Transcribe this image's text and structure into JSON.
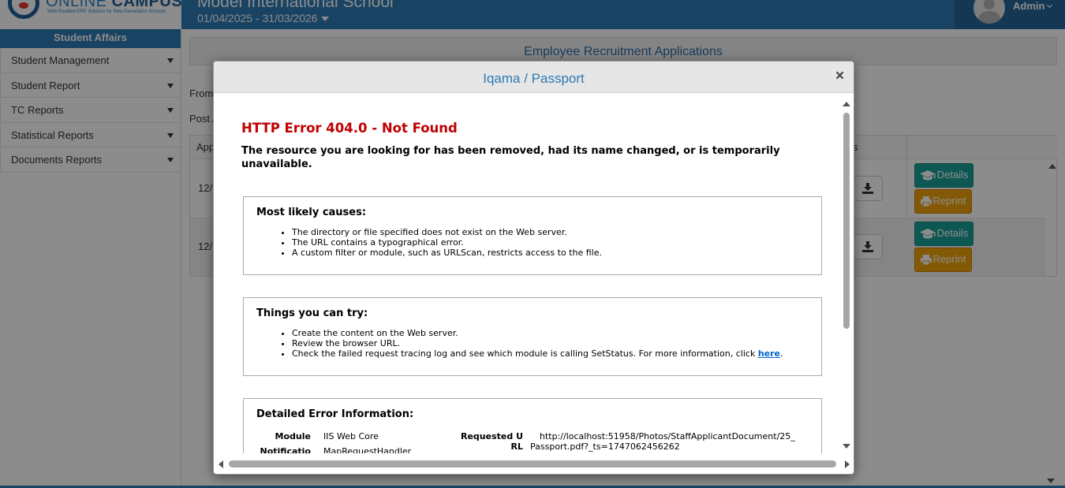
{
  "app": {
    "logo_brand_a": "ONLINE",
    "logo_brand_b": "CAMPUS",
    "logo_tagline": "Web Enabled ERP Solution for New Generation Schools",
    "school_name": "Model International School",
    "session": "01/04/2025 - 31/03/2026",
    "user": "Admin"
  },
  "sidebar": {
    "header": "Student Affairs",
    "items": [
      {
        "label": "Student Management"
      },
      {
        "label": "Student Report"
      },
      {
        "label": "TC Reports"
      },
      {
        "label": "Statistical Reports"
      },
      {
        "label": "Documents Reports"
      }
    ]
  },
  "main": {
    "title": "Employee Recruitment Applications",
    "from_label": "From",
    "post_label": "Post A",
    "grid_head_left": "App",
    "grid_head_right": "s",
    "rows": [
      {
        "date": "12/",
        "details": "Details",
        "reprint": "Reprint"
      },
      {
        "date": "12/",
        "details": "Details",
        "reprint": "Reprint"
      }
    ]
  },
  "modal": {
    "title": "Iqama / Passport",
    "close": "×",
    "error_title": "HTTP Error 404.0 - Not Found",
    "error_subtitle": "The resource you are looking for has been removed, had its name changed, or is temporarily unavailable.",
    "causes": {
      "heading": "Most likely causes:",
      "items": [
        "The directory or file specified does not exist on the Web server.",
        "The URL contains a typographical error.",
        "A custom filter or module, such as URLScan, restricts access to the file."
      ]
    },
    "try": {
      "heading": "Things you can try:",
      "items": [
        "Create the content on the Web server.",
        "Review the browser URL."
      ],
      "item3_prefix": "Check the failed request tracing log and see which module is calling SetStatus. For more information, click ",
      "item3_link": "here",
      "item3_suffix": "."
    },
    "detail": {
      "heading": "Detailed Error Information:",
      "module_label": "Module",
      "module_value": "IIS Web Core",
      "notification_label": "Notificatio",
      "notification_value": "MapRequestHandler",
      "url_label_1": "Requested U",
      "url_label_2": "RL",
      "url_value_1": "http://localhost:51958/Photos/StaffApplicantDocument/25_",
      "url_value_2": "Passport.pdf?_ts=1747062456262"
    }
  },
  "colors": {
    "primary": "#2d7bb5",
    "error_red": "#c00000",
    "details_btn": "#1aa098",
    "reprint_btn": "#f0a30a"
  },
  "icons": {
    "close": "close-icon",
    "graduation": "graduation-cap-icon",
    "printer": "printer-icon",
    "download": "download-icon",
    "dropdown": "caret-down-icon"
  }
}
